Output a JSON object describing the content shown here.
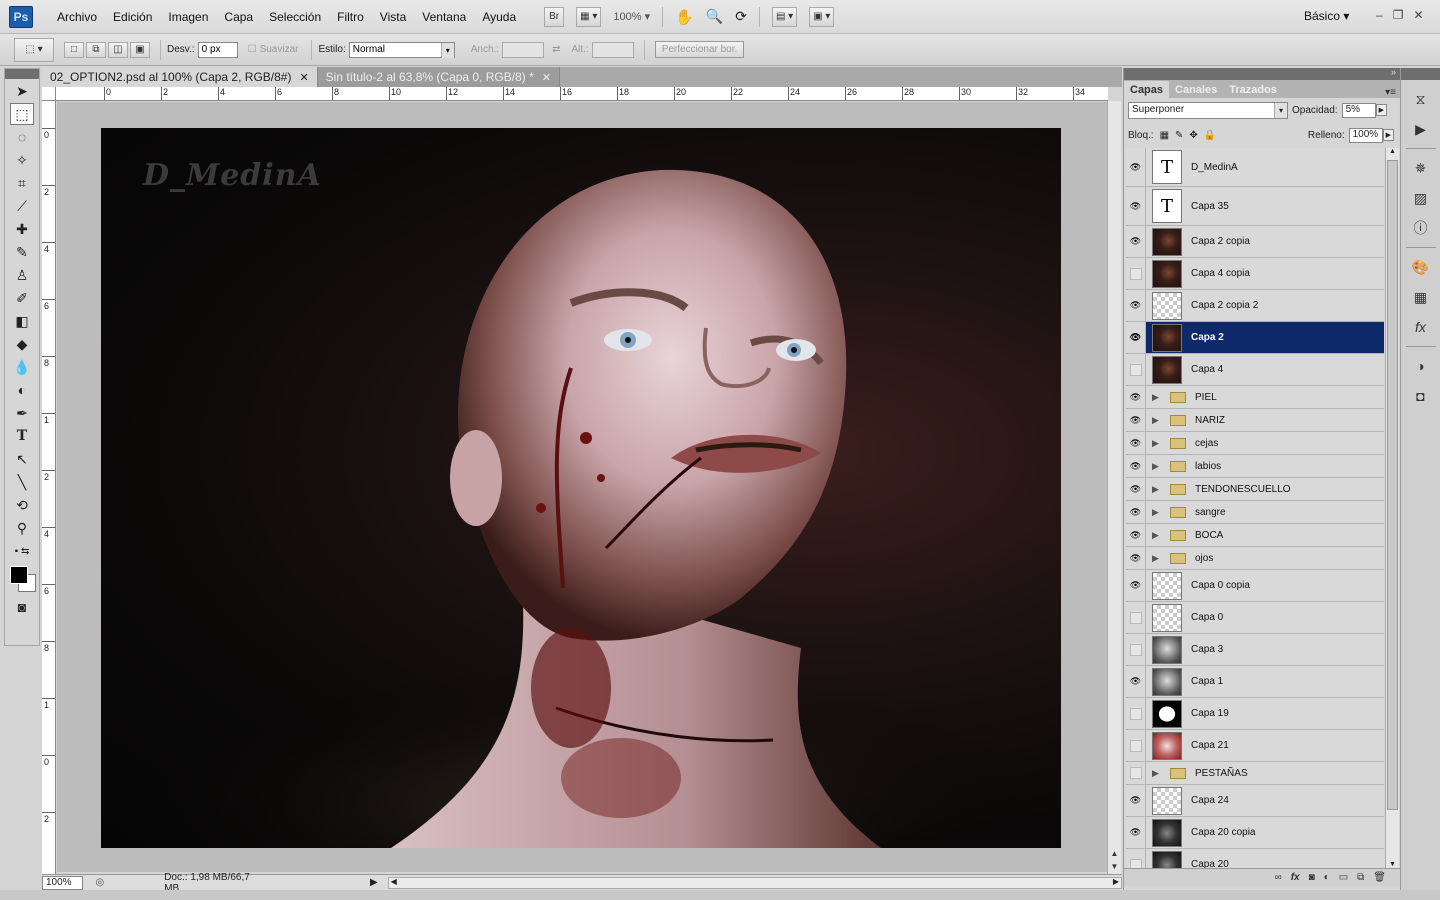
{
  "app": {
    "logo": "Ps"
  },
  "menu": [
    "Archivo",
    "Edición",
    "Imagen",
    "Capa",
    "Selección",
    "Filtro",
    "Vista",
    "Ventana",
    "Ayuda"
  ],
  "menubar_tools": {
    "bridge": "Br",
    "zoom": "100%"
  },
  "workspace": "Básico",
  "options": {
    "feather_label": "Desv.:",
    "feather_value": "0 px",
    "antialias_label": "Suavizar",
    "style_label": "Estilo:",
    "style_value": "Normal",
    "width_label": "Anch.:",
    "height_label": "Alt.:",
    "refine_button": "Perfeccionar bor."
  },
  "tabs": [
    {
      "label": "02_OPTION2.psd al 100% (Capa 2, RGB/8#)",
      "active": true
    },
    {
      "label": "Sin título-2 al 63,8% (Capa 0, RGB/8) *",
      "active": false
    }
  ],
  "ruler_h_labels": [
    "0",
    "2",
    "4",
    "6",
    "8",
    "10",
    "12",
    "14",
    "16",
    "18",
    "20",
    "22",
    "24",
    "26",
    "28",
    "30",
    "32",
    "34"
  ],
  "ruler_v_labels": [
    "0",
    "2",
    "4",
    "6",
    "8",
    "1",
    "2",
    "4",
    "6",
    "8",
    "1",
    "0",
    "2"
  ],
  "artwork": {
    "watermark": "D_MedinA"
  },
  "status": {
    "zoom": "100%",
    "doc": "Doc.: 1,98 MB/66,7 MB"
  },
  "layers_panel": {
    "tabs": [
      "Capas",
      "Canales",
      "Trazados"
    ],
    "blend_mode": "Superponer",
    "opacity_label": "Opacidad:",
    "opacity": "5%",
    "lock_label": "Bloq.:",
    "fill_label": "Relleno:",
    "fill": "100%",
    "layers": [
      {
        "name": "D_MedinA",
        "type": "text",
        "visible": true,
        "selected": false
      },
      {
        "name": "Capa 35",
        "type": "text",
        "visible": true,
        "selected": false
      },
      {
        "name": "Capa 2 copia",
        "type": "face",
        "visible": true,
        "selected": false
      },
      {
        "name": "Capa 4 copia",
        "type": "face",
        "visible": false,
        "selected": false
      },
      {
        "name": "Capa 2 copia 2",
        "type": "checker",
        "visible": true,
        "selected": false
      },
      {
        "name": "Capa 2",
        "type": "face",
        "visible": true,
        "selected": true
      },
      {
        "name": "Capa 4",
        "type": "face",
        "visible": false,
        "selected": false
      },
      {
        "name": "PIEL",
        "type": "group",
        "visible": true,
        "selected": false
      },
      {
        "name": "NARIZ",
        "type": "group",
        "visible": true,
        "selected": false
      },
      {
        "name": "cejas",
        "type": "group",
        "visible": true,
        "selected": false
      },
      {
        "name": "labios",
        "type": "group",
        "visible": true,
        "selected": false
      },
      {
        "name": "TENDONESCUELLO",
        "type": "group",
        "visible": true,
        "selected": false
      },
      {
        "name": "sangre",
        "type": "group",
        "visible": true,
        "selected": false
      },
      {
        "name": "BOCA",
        "type": "group",
        "visible": true,
        "selected": false
      },
      {
        "name": "ojos",
        "type": "group",
        "visible": true,
        "selected": false
      },
      {
        "name": "Capa 0 copia",
        "type": "checker",
        "visible": true,
        "selected": false
      },
      {
        "name": "Capa 0",
        "type": "checker",
        "visible": false,
        "selected": false
      },
      {
        "name": "Capa 3",
        "type": "sketch",
        "visible": false,
        "selected": false
      },
      {
        "name": "Capa 1",
        "type": "sketch",
        "visible": true,
        "selected": false
      },
      {
        "name": "Capa 19",
        "type": "mask",
        "visible": false,
        "selected": false
      },
      {
        "name": "Capa 21",
        "type": "red",
        "visible": false,
        "selected": false
      },
      {
        "name": "PESTAÑAS",
        "type": "group",
        "visible": false,
        "selected": false
      },
      {
        "name": "Capa 24",
        "type": "checker",
        "visible": true,
        "selected": false
      },
      {
        "name": "Capa 20 copia",
        "type": "dark",
        "visible": true,
        "selected": false
      },
      {
        "name": "Capa 20",
        "type": "dark",
        "visible": false,
        "selected": false
      }
    ]
  },
  "panel_footer_icons": [
    "link-icon",
    "fx-icon",
    "mask-icon",
    "adjustment-icon",
    "folder-icon",
    "new-layer-icon",
    "trash-icon"
  ],
  "dock_icons": [
    "history-icon",
    "actions-icon",
    "navigator-icon",
    "histogram-icon",
    "info-icon",
    "color-icon",
    "swatches-icon",
    "styles-icon",
    "adjustments-icon",
    "masks-icon"
  ]
}
